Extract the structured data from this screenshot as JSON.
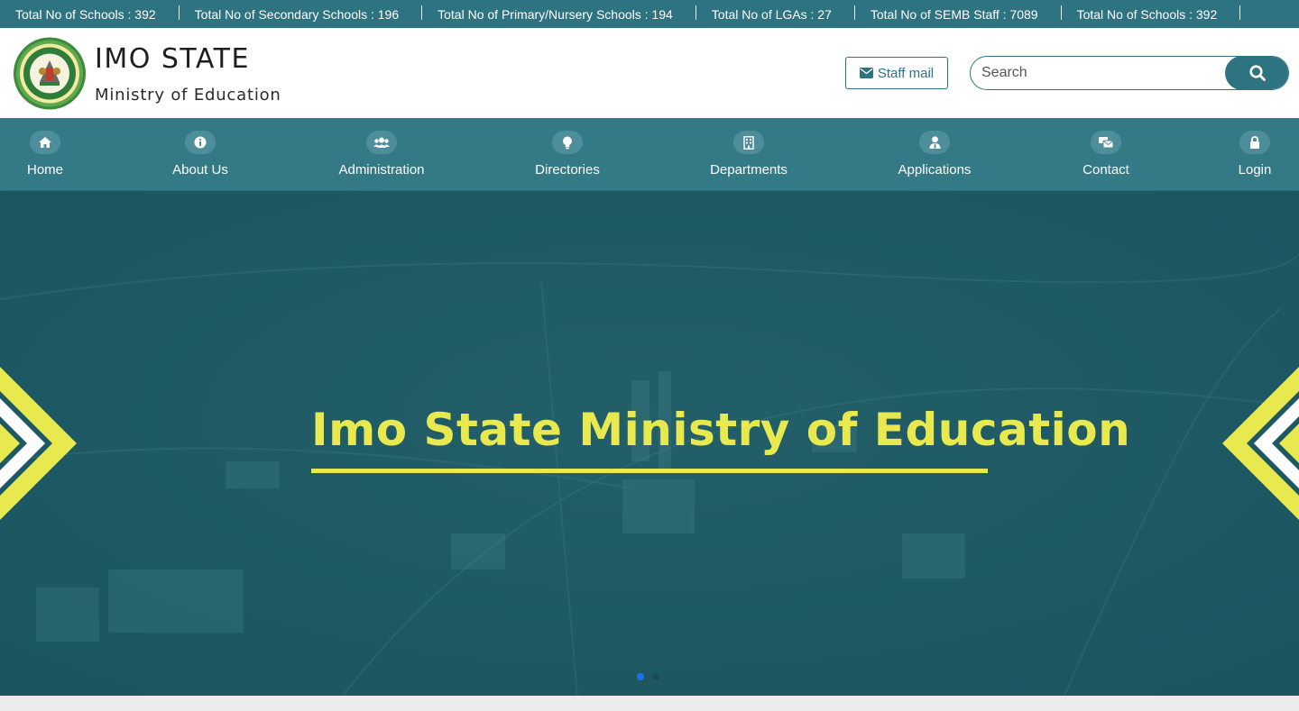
{
  "ticker": {
    "items": [
      "Total No of Schools : 392",
      "Total No of Secondary Schools : 196",
      "Total No of Primary/Nursery Schools : 194",
      "Total No of LGAs : 27",
      "Total No of SEMB Staff : 7089",
      "Total No of Schools : 392"
    ]
  },
  "header": {
    "title": "IMO STATE",
    "subtitle": "Ministry of Education",
    "staff_mail_label": "Staff mail",
    "search_placeholder": "Search"
  },
  "nav": {
    "items": [
      {
        "label": "Home",
        "icon": "home-icon"
      },
      {
        "label": "About Us",
        "icon": "info-icon"
      },
      {
        "label": "Administration",
        "icon": "users-icon"
      },
      {
        "label": "Directories",
        "icon": "lightbulb-icon"
      },
      {
        "label": "Departments",
        "icon": "building-icon"
      },
      {
        "label": "Applications",
        "icon": "user-tie-icon"
      },
      {
        "label": "Contact",
        "icon": "contact-icon"
      },
      {
        "label": "Login",
        "icon": "lock-icon"
      }
    ]
  },
  "hero": {
    "title": "Imo State Ministry of Education",
    "active_slide": 1,
    "slide_count": 2
  },
  "colors": {
    "primary": "#2d7382",
    "accent_yellow": "#e7e94f",
    "dot_active": "#1a73e8",
    "dot_inactive": "#1c4a52"
  }
}
